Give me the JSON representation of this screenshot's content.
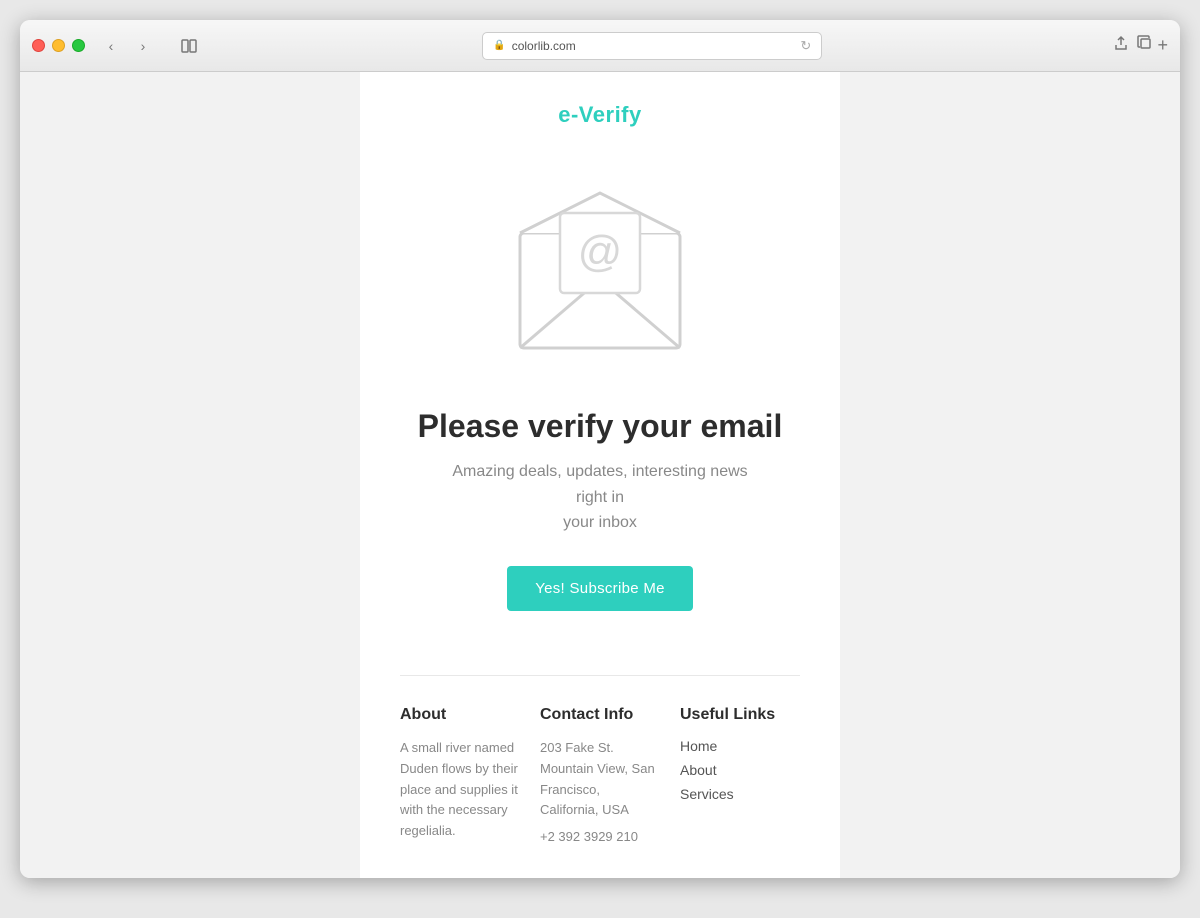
{
  "browser": {
    "url": "colorlib.com",
    "back_btn": "‹",
    "forward_btn": "›"
  },
  "header": {
    "logo": "e-Verify"
  },
  "main": {
    "heading": "Please verify your email",
    "subtext_line1": "Amazing deals, updates, interesting news right in",
    "subtext_line2": "your inbox",
    "subscribe_btn": "Yes! Subscribe Me"
  },
  "footer": {
    "about": {
      "title": "About",
      "text": "A small river named Duden flows by their place and supplies it with the necessary regelialia."
    },
    "contact": {
      "title": "Contact Info",
      "address": "203 Fake St. Mountain View, San Francisco, California, USA",
      "phone": "+2 392 3929 210"
    },
    "links": {
      "title": "Useful Links",
      "items": [
        "Home",
        "About",
        "Services"
      ]
    }
  },
  "envelope": {
    "color": "#d8d8d8"
  }
}
